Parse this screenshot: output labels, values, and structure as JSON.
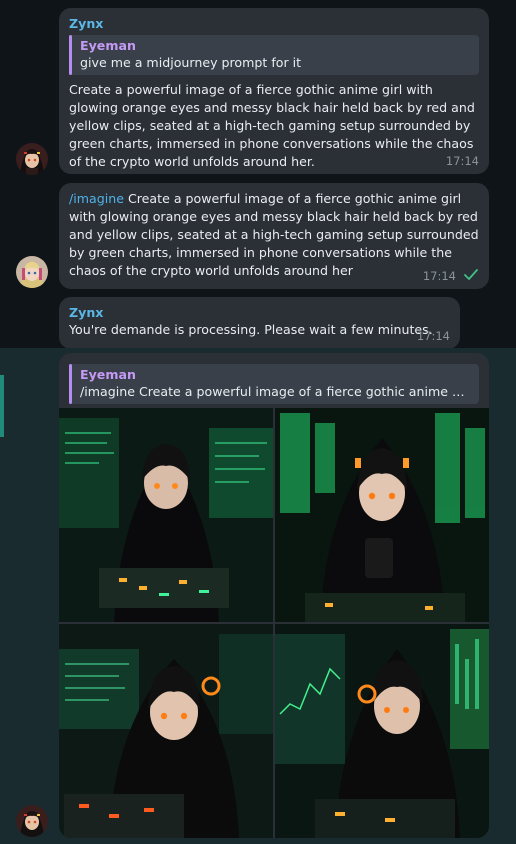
{
  "messages": [
    {
      "sender": "Zynx",
      "reply": {
        "name": "Eyeman",
        "text": "give me a midjourney prompt for it"
      },
      "text": "Create a powerful image of a fierce gothic anime girl with glowing orange eyes and messy black hair held back by red and yellow clips, seated at a high-tech gaming setup surrounded by green charts, immersed in phone conversations while the chaos of the crypto world unfolds around her.",
      "time": "17:14"
    },
    {
      "command": "/imagine",
      "text": "Create a powerful image of a fierce gothic anime girl with glowing orange eyes and messy black hair held back by red and yellow clips, seated at a high-tech gaming setup surrounded by green charts, immersed in phone conversations while the chaos of the crypto world unfolds around her",
      "time": "17:14"
    },
    {
      "sender": "Zynx",
      "text": "You're demande is processing. Please wait a few minutes.",
      "time": "17:14"
    },
    {
      "reply": {
        "name": "Eyeman",
        "text": "/imagine Create a powerful image of a fierce gothic anime girl wit..."
      }
    }
  ],
  "colors": {
    "background": "#0f1419",
    "bubble": "#2b2f36",
    "sender_name": "#5bb7e6",
    "reply_accent": "#b78ef0",
    "command": "#4fb3e8",
    "highlight": "#1a2b30"
  }
}
